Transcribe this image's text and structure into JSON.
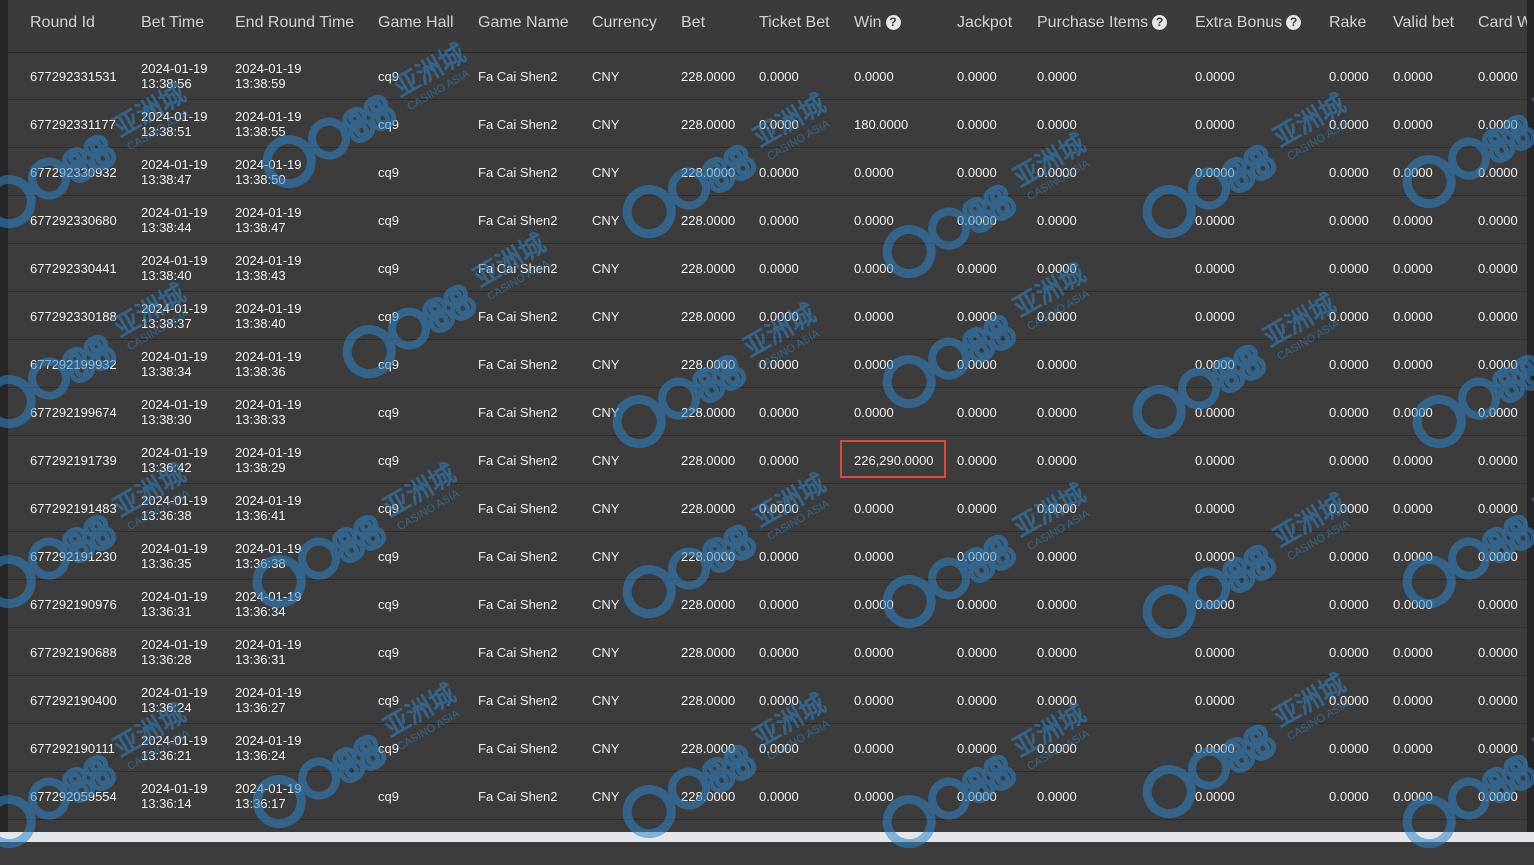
{
  "columns": [
    {
      "label": "Round Id",
      "help": false
    },
    {
      "label": "Bet Time",
      "help": false
    },
    {
      "label": "End Round Time",
      "help": false
    },
    {
      "label": "Game Hall",
      "help": false
    },
    {
      "label": "Game Name",
      "help": false
    },
    {
      "label": "Currency",
      "help": false
    },
    {
      "label": "Bet",
      "help": false
    },
    {
      "label": "Ticket Bet",
      "help": false
    },
    {
      "label": "Win",
      "help": true
    },
    {
      "label": "Jackpot",
      "help": false
    },
    {
      "label": "Purchase Items",
      "help": true
    },
    {
      "label": "Extra Bonus",
      "help": true
    },
    {
      "label": "Rake",
      "help": false
    },
    {
      "label": "Valid bet",
      "help": false
    },
    {
      "label": "Card W",
      "help": false
    }
  ],
  "help_icon": "question-circle-icon",
  "rows": [
    {
      "round_id": "677292331531",
      "bet_date": "2024-01-19",
      "bet_time": "13:38:56",
      "end_date": "2024-01-19",
      "end_time": "13:38:59",
      "hall": "cq9",
      "game": "Fa Cai Shen2",
      "currency": "CNY",
      "bet": "228.0000",
      "ticket_bet": "0.0000",
      "win": "0.0000",
      "jackpot": "0.0000",
      "purchase": "0.0000",
      "extra_bonus": "0.0000",
      "rake": "0.0000",
      "valid_bet": "0.0000",
      "card_w": "0.0000"
    },
    {
      "round_id": "677292331177",
      "bet_date": "2024-01-19",
      "bet_time": "13:38:51",
      "end_date": "2024-01-19",
      "end_time": "13:38:55",
      "hall": "cq9",
      "game": "Fa Cai Shen2",
      "currency": "CNY",
      "bet": "228.0000",
      "ticket_bet": "0.0000",
      "win": "180.0000",
      "jackpot": "0.0000",
      "purchase": "0.0000",
      "extra_bonus": "0.0000",
      "rake": "0.0000",
      "valid_bet": "0.0000",
      "card_w": "0.0000"
    },
    {
      "round_id": "677292330932",
      "bet_date": "2024-01-19",
      "bet_time": "13:38:47",
      "end_date": "2024-01-19",
      "end_time": "13:38:50",
      "hall": "cq9",
      "game": "Fa Cai Shen2",
      "currency": "CNY",
      "bet": "228.0000",
      "ticket_bet": "0.0000",
      "win": "0.0000",
      "jackpot": "0.0000",
      "purchase": "0.0000",
      "extra_bonus": "0.0000",
      "rake": "0.0000",
      "valid_bet": "0.0000",
      "card_w": "0.0000"
    },
    {
      "round_id": "677292330680",
      "bet_date": "2024-01-19",
      "bet_time": "13:38:44",
      "end_date": "2024-01-19",
      "end_time": "13:38:47",
      "hall": "cq9",
      "game": "Fa Cai Shen2",
      "currency": "CNY",
      "bet": "228.0000",
      "ticket_bet": "0.0000",
      "win": "0.0000",
      "jackpot": "0.0000",
      "purchase": "0.0000",
      "extra_bonus": "0.0000",
      "rake": "0.0000",
      "valid_bet": "0.0000",
      "card_w": "0.0000"
    },
    {
      "round_id": "677292330441",
      "bet_date": "2024-01-19",
      "bet_time": "13:38:40",
      "end_date": "2024-01-19",
      "end_time": "13:38:43",
      "hall": "cq9",
      "game": "Fa Cai Shen2",
      "currency": "CNY",
      "bet": "228.0000",
      "ticket_bet": "0.0000",
      "win": "0.0000",
      "jackpot": "0.0000",
      "purchase": "0.0000",
      "extra_bonus": "0.0000",
      "rake": "0.0000",
      "valid_bet": "0.0000",
      "card_w": "0.0000"
    },
    {
      "round_id": "677292330188",
      "bet_date": "2024-01-19",
      "bet_time": "13:38:37",
      "end_date": "2024-01-19",
      "end_time": "13:38:40",
      "hall": "cq9",
      "game": "Fa Cai Shen2",
      "currency": "CNY",
      "bet": "228.0000",
      "ticket_bet": "0.0000",
      "win": "0.0000",
      "jackpot": "0.0000",
      "purchase": "0.0000",
      "extra_bonus": "0.0000",
      "rake": "0.0000",
      "valid_bet": "0.0000",
      "card_w": "0.0000"
    },
    {
      "round_id": "677292199932",
      "bet_date": "2024-01-19",
      "bet_time": "13:38:34",
      "end_date": "2024-01-19",
      "end_time": "13:38:36",
      "hall": "cq9",
      "game": "Fa Cai Shen2",
      "currency": "CNY",
      "bet": "228.0000",
      "ticket_bet": "0.0000",
      "win": "0.0000",
      "jackpot": "0.0000",
      "purchase": "0.0000",
      "extra_bonus": "0.0000",
      "rake": "0.0000",
      "valid_bet": "0.0000",
      "card_w": "0.0000"
    },
    {
      "round_id": "677292199674",
      "bet_date": "2024-01-19",
      "bet_time": "13:38:30",
      "end_date": "2024-01-19",
      "end_time": "13:38:33",
      "hall": "cq9",
      "game": "Fa Cai Shen2",
      "currency": "CNY",
      "bet": "228.0000",
      "ticket_bet": "0.0000",
      "win": "0.0000",
      "jackpot": "0.0000",
      "purchase": "0.0000",
      "extra_bonus": "0.0000",
      "rake": "0.0000",
      "valid_bet": "0.0000",
      "card_w": "0.0000"
    },
    {
      "round_id": "677292191739",
      "bet_date": "2024-01-19",
      "bet_time": "13:36:42",
      "end_date": "2024-01-19",
      "end_time": "13:38:29",
      "hall": "cq9",
      "game": "Fa Cai Shen2",
      "currency": "CNY",
      "bet": "228.0000",
      "ticket_bet": "0.0000",
      "win": "226,290.0000",
      "jackpot": "0.0000",
      "purchase": "0.0000",
      "extra_bonus": "0.0000",
      "rake": "0.0000",
      "valid_bet": "0.0000",
      "card_w": "0.0000",
      "highlighted": true
    },
    {
      "round_id": "677292191483",
      "bet_date": "2024-01-19",
      "bet_time": "13:36:38",
      "end_date": "2024-01-19",
      "end_time": "13:36:41",
      "hall": "cq9",
      "game": "Fa Cai Shen2",
      "currency": "CNY",
      "bet": "228.0000",
      "ticket_bet": "0.0000",
      "win": "0.0000",
      "jackpot": "0.0000",
      "purchase": "0.0000",
      "extra_bonus": "0.0000",
      "rake": "0.0000",
      "valid_bet": "0.0000",
      "card_w": "0.0000"
    },
    {
      "round_id": "677292191230",
      "bet_date": "2024-01-19",
      "bet_time": "13:36:35",
      "end_date": "2024-01-19",
      "end_time": "13:36:38",
      "hall": "cq9",
      "game": "Fa Cai Shen2",
      "currency": "CNY",
      "bet": "228.0000",
      "ticket_bet": "0.0000",
      "win": "0.0000",
      "jackpot": "0.0000",
      "purchase": "0.0000",
      "extra_bonus": "0.0000",
      "rake": "0.0000",
      "valid_bet": "0.0000",
      "card_w": "0.0000"
    },
    {
      "round_id": "677292190976",
      "bet_date": "2024-01-19",
      "bet_time": "13:36:31",
      "end_date": "2024-01-19",
      "end_time": "13:36:34",
      "hall": "cq9",
      "game": "Fa Cai Shen2",
      "currency": "CNY",
      "bet": "228.0000",
      "ticket_bet": "0.0000",
      "win": "0.0000",
      "jackpot": "0.0000",
      "purchase": "0.0000",
      "extra_bonus": "0.0000",
      "rake": "0.0000",
      "valid_bet": "0.0000",
      "card_w": "0.0000"
    },
    {
      "round_id": "677292190688",
      "bet_date": "2024-01-19",
      "bet_time": "13:36:28",
      "end_date": "2024-01-19",
      "end_time": "13:36:31",
      "hall": "cq9",
      "game": "Fa Cai Shen2",
      "currency": "CNY",
      "bet": "228.0000",
      "ticket_bet": "0.0000",
      "win": "0.0000",
      "jackpot": "0.0000",
      "purchase": "0.0000",
      "extra_bonus": "0.0000",
      "rake": "0.0000",
      "valid_bet": "0.0000",
      "card_w": "0.0000"
    },
    {
      "round_id": "677292190400",
      "bet_date": "2024-01-19",
      "bet_time": "13:36:24",
      "end_date": "2024-01-19",
      "end_time": "13:36:27",
      "hall": "cq9",
      "game": "Fa Cai Shen2",
      "currency": "CNY",
      "bet": "228.0000",
      "ticket_bet": "0.0000",
      "win": "0.0000",
      "jackpot": "0.0000",
      "purchase": "0.0000",
      "extra_bonus": "0.0000",
      "rake": "0.0000",
      "valid_bet": "0.0000",
      "card_w": "0.0000"
    },
    {
      "round_id": "677292190111",
      "bet_date": "2024-01-19",
      "bet_time": "13:36:21",
      "end_date": "2024-01-19",
      "end_time": "13:36:24",
      "hall": "cq9",
      "game": "Fa Cai Shen2",
      "currency": "CNY",
      "bet": "228.0000",
      "ticket_bet": "0.0000",
      "win": "0.0000",
      "jackpot": "0.0000",
      "purchase": "0.0000",
      "extra_bonus": "0.0000",
      "rake": "0.0000",
      "valid_bet": "0.0000",
      "card_w": "0.0000"
    },
    {
      "round_id": "677292059554",
      "bet_date": "2024-01-19",
      "bet_time": "13:36:14",
      "end_date": "2024-01-19",
      "end_time": "13:36:17",
      "hall": "cq9",
      "game": "Fa Cai Shen2",
      "currency": "CNY",
      "bet": "228.0000",
      "ticket_bet": "0.0000",
      "win": "0.0000",
      "jackpot": "0.0000",
      "purchase": "0.0000",
      "extra_bonus": "0.0000",
      "rake": "0.0000",
      "valid_bet": "0.0000",
      "card_w": "0.0000"
    }
  ],
  "watermark": {
    "brand": "CA88",
    "cn_text": "亚洲城",
    "en_text": "CASINO ASIA",
    "color": "#2f86c8"
  },
  "colors": {
    "highlight_border": "#e0463a",
    "background": "#3c3c3c",
    "text": "#f2f2f2",
    "header_text": "#d2d2d2"
  }
}
